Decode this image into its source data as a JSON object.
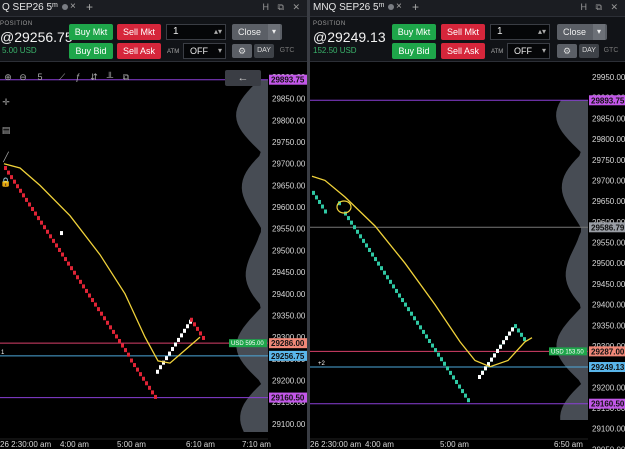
{
  "colors": {
    "bull_brick": "#ffffff",
    "bear_brick": "#e02436",
    "bull_brick_right": "#2fc9a4",
    "ma_line": "#f0d23a",
    "level_purple": "#8a3fd6",
    "level_pink": "#d8406a",
    "level_cyan": "#4da8da",
    "tag_purple": "#c257e8",
    "tag_salmon": "#f08878",
    "tag_blue": "#5ab6ea",
    "tag_green": "#1ea64a",
    "buy": "#1ea64a",
    "sell": "#d6263b"
  },
  "left": {
    "tab": {
      "title": "Q SEP26 5",
      "superscript": "m",
      "close": "×",
      "add": "+",
      "icons": "H ⧉ ✕"
    },
    "position": {
      "label": "POSITION",
      "price": "@29256.75",
      "pnl": "5.00 USD"
    },
    "buttons": {
      "buy_mkt": "Buy Mkt",
      "sell_mkt": "Sell Mkt",
      "buy_bid": "Buy Bid",
      "sell_ask": "Sell Ask",
      "close": "Close",
      "gear": "⚙",
      "day": "DAY",
      "gtc": "GTC"
    },
    "quantity": "1",
    "atm": {
      "label": "ATM",
      "value": "OFF"
    },
    "toolbar": {
      "back": "←",
      "timeframe": "5"
    },
    "price_axis": [
      "29900.00",
      "29850.00",
      "29800.00",
      "29750.00",
      "29700.00",
      "29650.00",
      "29600.00",
      "29550.00",
      "29500.00",
      "29450.00",
      "29400.00",
      "29350.00",
      "29300.00",
      "29250.00",
      "29200.00",
      "29150.00",
      "29100.00"
    ],
    "tags": {
      "top": "29893.75",
      "pink": "29286.00",
      "current": "29256.75",
      "purple_low": "29160.50"
    },
    "pl_tag": "USD 595.00",
    "qty_marker": "1",
    "time_axis": [
      "26 2:30:00 am",
      "4:00 am",
      "5:00 am",
      "6:10 am",
      "7:10 am"
    ]
  },
  "right": {
    "tab": {
      "title": "MNQ SEP26 5",
      "superscript": "m",
      "close": "×",
      "add": "+",
      "icons": "H ⧉ ✕"
    },
    "position": {
      "label": "POSITION",
      "price": "@29249.13",
      "pnl": "152.50 USD"
    },
    "buttons": {
      "buy_mkt": "Buy Mkt",
      "sell_mkt": "Sell Mkt",
      "buy_bid": "Buy Bid",
      "sell_ask": "Sell Ask",
      "close": "Close",
      "gear": "⚙",
      "day": "DAY",
      "gtc": "GTC"
    },
    "quantity": "1",
    "atm": {
      "label": "ATM",
      "value": "OFF"
    },
    "price_axis": [
      "29950.00",
      "29900.00",
      "29850.00",
      "29800.00",
      "29750.00",
      "29700.00",
      "29650.00",
      "29600.00",
      "29550.00",
      "29500.00",
      "29450.00",
      "29400.00",
      "29350.00",
      "29300.00",
      "29250.00",
      "29200.00",
      "29150.00",
      "29100.00",
      "29050.00"
    ],
    "tags": {
      "top": "29893.75",
      "gray": "29586.79",
      "pink": "29287.00",
      "current": "29249.13",
      "purple_low": "29160.50"
    },
    "pl_tag": "USD 153.50",
    "qty_marker": "+2",
    "time_axis": [
      "26 2:30:00 am",
      "4:00 am",
      "5:00 am",
      "6:50 am"
    ]
  }
}
